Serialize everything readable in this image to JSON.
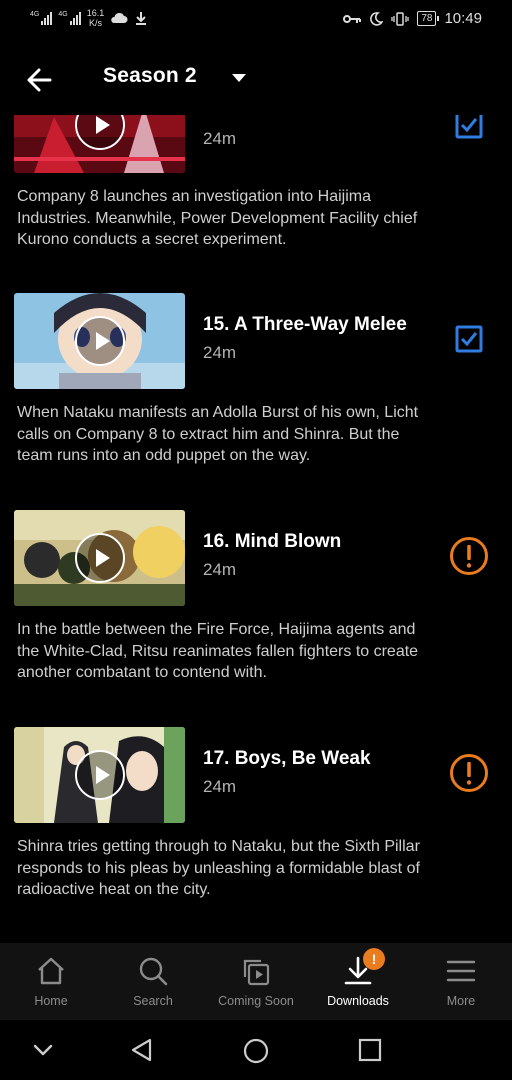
{
  "status_bar": {
    "net1": "4G",
    "net2": "4G",
    "speed_value": "16.1",
    "speed_unit": "K/s",
    "battery": "78",
    "time": "10:49"
  },
  "header": {
    "title": "Season 2"
  },
  "episodes": [
    {
      "title": "",
      "duration": "24m",
      "description": "Company 8 launches an investigation into Haijima Industries. Meanwhile, Power Development Facility chief Kurono conducts a secret experiment.",
      "status_icon": "checkbox-checked-icon"
    },
    {
      "title": "15. A Three-Way Melee",
      "duration": "24m",
      "description": "When Nataku manifests an Adolla Burst of his own, Licht calls on Company 8 to extract him and Shinra. But the team runs into an odd puppet on the way.",
      "status_icon": "checkbox-checked-icon"
    },
    {
      "title": "16. Mind Blown",
      "duration": "24m",
      "description": "In the battle between the Fire Force, Haijima agents and the White-Clad, Ritsu reanimates fallen fighters to create another combatant to contend with.",
      "status_icon": "warning-circle-icon"
    },
    {
      "title": "17. Boys, Be Weak",
      "duration": "24m",
      "description": "Shinra tries getting through to Nataku, but the Sixth Pillar responds to his pleas by unleashing a formidable blast of radioactive heat on the city.",
      "status_icon": "warning-circle-icon"
    }
  ],
  "bottom_nav": {
    "items": [
      {
        "label": "Home",
        "icon": "home-icon"
      },
      {
        "label": "Search",
        "icon": "search-icon"
      },
      {
        "label": "Coming Soon",
        "icon": "coming-soon-icon"
      },
      {
        "label": "Downloads",
        "icon": "download-icon"
      },
      {
        "label": "More",
        "icon": "menu-icon"
      }
    ],
    "active": "Downloads",
    "downloads_badge": "!"
  },
  "colors": {
    "background": "#000000",
    "checkbox_blue": "#2f7de1",
    "warning_orange": "#e87c1e",
    "nav_background": "#121212"
  }
}
